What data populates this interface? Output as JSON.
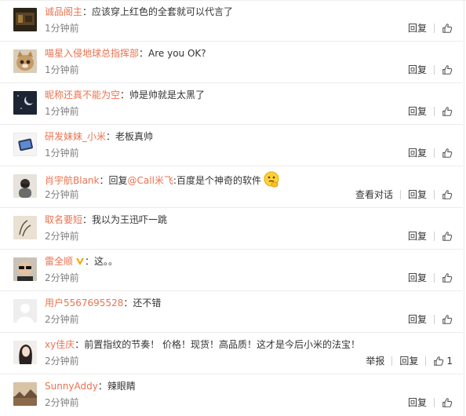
{
  "comments": [
    {
      "avatar": "avatar-dark-photo",
      "user": "诚品阁主",
      "text": "：应该穿上红色的全套就可以代言了",
      "time": "1分钟前",
      "actions": [
        "回复"
      ],
      "likes": ""
    },
    {
      "avatar": "avatar-cat-photo",
      "user": "喵星入侵地球总指挥部",
      "text": "：Are you OK?",
      "time": "1分钟前",
      "actions": [
        "回复"
      ],
      "likes": ""
    },
    {
      "avatar": "avatar-night-sky",
      "user": "昵称还真不能为空",
      "text": "：帅是帅就是太黑了",
      "time": "1分钟前",
      "actions": [
        "回复"
      ],
      "likes": ""
    },
    {
      "avatar": "avatar-phone-photo",
      "user": "研发妹妹_小米",
      "text": "：老板真帅",
      "time": "1分钟前",
      "actions": [
        "回复"
      ],
      "likes": ""
    },
    {
      "avatar": "avatar-person-photo",
      "user": "肖宇航Blank",
      "text_prefix": "：回复",
      "mention": "@Call米飞",
      "text": ":百度是个神奇的软件",
      "emoji": "thinking-emoji",
      "time": "2分钟前",
      "actions": [
        "查看对话",
        "回复"
      ],
      "likes": ""
    },
    {
      "avatar": "avatar-sketch",
      "user": "取名要短",
      "text": "：我以为王迅吓一跳",
      "time": "2分钟前",
      "actions": [
        "回复"
      ],
      "likes": ""
    },
    {
      "avatar": "avatar-sunglasses",
      "user": "雷全顺",
      "verified": "verified-badge-icon",
      "text": "：这。。",
      "time": "2分钟前",
      "actions": [
        "回复"
      ],
      "likes": ""
    },
    {
      "avatar": "avatar-default",
      "user": "用户5567695528",
      "text": "：还不错",
      "time": "2分钟前",
      "actions": [
        "回复"
      ],
      "likes": ""
    },
    {
      "avatar": "avatar-woman-photo",
      "user": "xy佳庆",
      "text": "：前置指纹的节奏！ 价格！现货！高品质！这才是今后小米的法宝！",
      "time": "2分钟前",
      "actions": [
        "举报",
        "回复"
      ],
      "likes": "1"
    },
    {
      "avatar": "avatar-landscape",
      "user": "SunnyAddy",
      "text": "：辣眼睛",
      "time": "2分钟前",
      "actions": [
        "回复"
      ],
      "likes": ""
    }
  ],
  "colors": {
    "username": "#eb7350",
    "text": "#333333",
    "time": "#808080"
  }
}
